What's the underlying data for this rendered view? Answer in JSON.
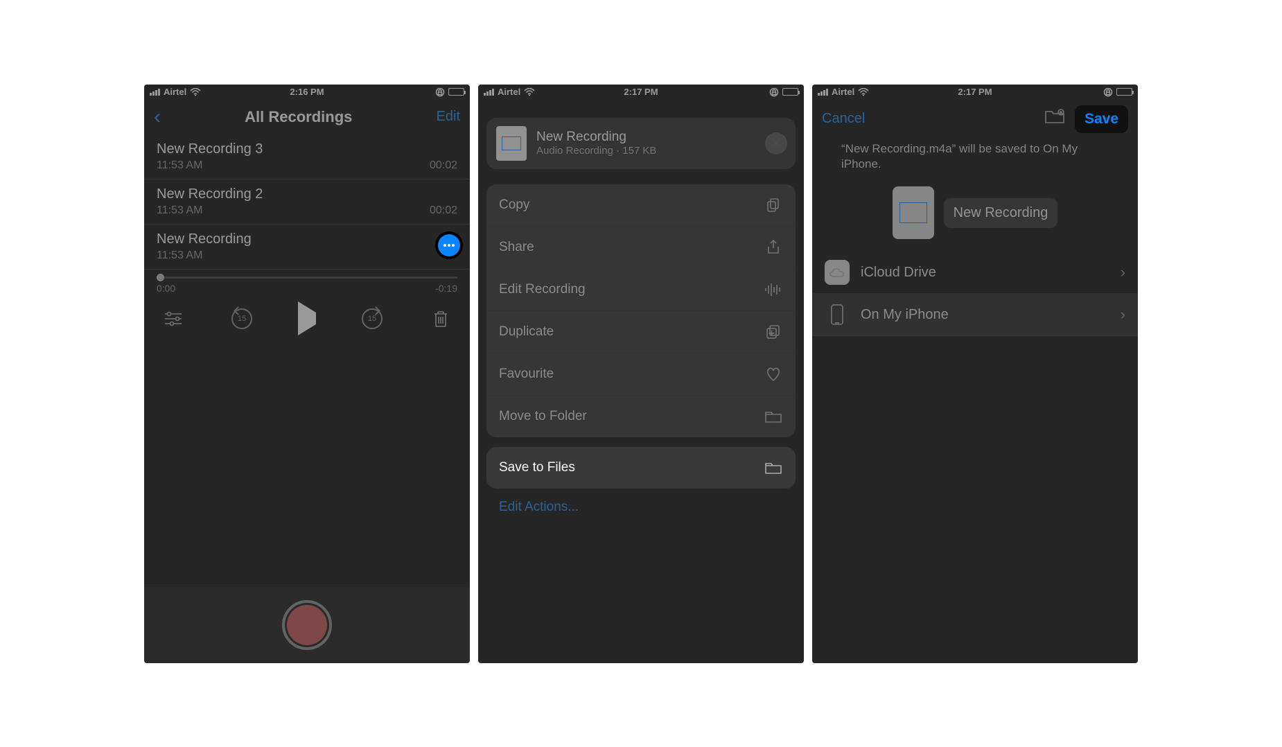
{
  "statusbar": {
    "carrier": "Airtel",
    "time1": "2:16 PM",
    "time2": "2:17 PM",
    "time3": "2:17 PM"
  },
  "screen1": {
    "title": "All Recordings",
    "edit": "Edit",
    "recordings": [
      {
        "name": "New Recording 3",
        "time": "11:53 AM",
        "dur": "00:02"
      },
      {
        "name": "New Recording 2",
        "time": "11:53 AM",
        "dur": "00:02"
      },
      {
        "name": "New Recording",
        "time": "11:53 AM",
        "dur": ""
      }
    ],
    "scrub_start": "0:00",
    "scrub_end": "-0:19",
    "skip_amount": "15"
  },
  "screen2": {
    "file_name": "New Recording",
    "file_meta": "Audio Recording · 157 KB",
    "actions": {
      "copy": "Copy",
      "share": "Share",
      "edit_recording": "Edit Recording",
      "duplicate": "Duplicate",
      "favourite": "Favourite",
      "move_to_folder": "Move to Folder",
      "save_to_files": "Save to Files",
      "edit_actions": "Edit Actions..."
    }
  },
  "screen3": {
    "cancel": "Cancel",
    "save": "Save",
    "message": "“New Recording.m4a” will be saved to On My iPhone.",
    "file_name": "New Recording",
    "locations": {
      "icloud": "iCloud Drive",
      "on_my_iphone": "On My iPhone"
    }
  }
}
